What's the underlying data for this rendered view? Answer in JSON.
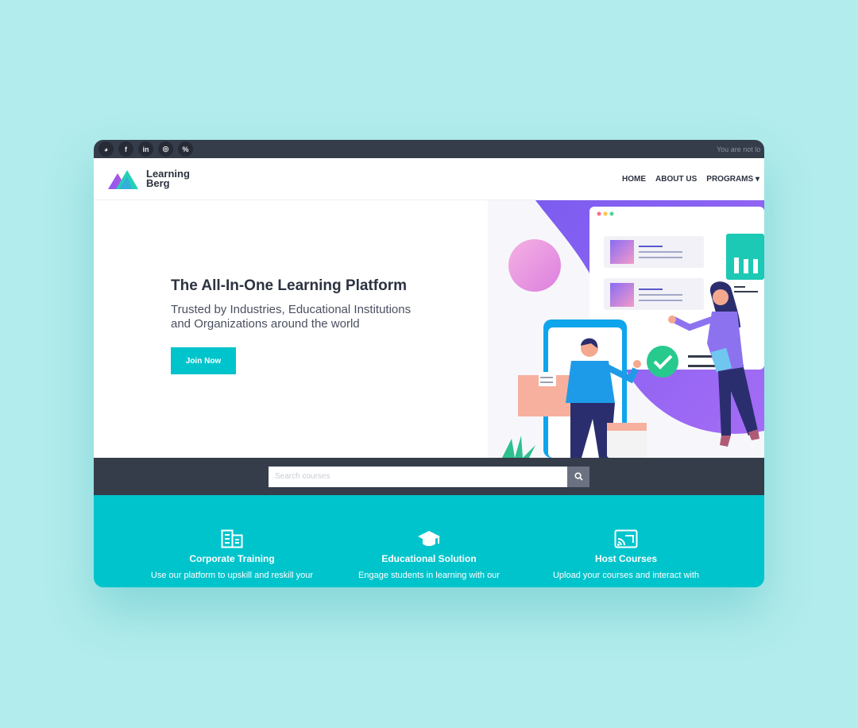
{
  "topbar": {
    "socials": [
      {
        "icon": "globe-icon",
        "glyph": "◕"
      },
      {
        "icon": "facebook-icon",
        "glyph": "f"
      },
      {
        "icon": "linkedin-icon",
        "glyph": "in"
      },
      {
        "icon": "instagram-icon",
        "glyph": "◎"
      },
      {
        "icon": "link-icon",
        "glyph": "%"
      }
    ],
    "login_note": "You are not lo"
  },
  "brand": {
    "line1": "Learning",
    "line2": "Berg"
  },
  "nav": {
    "home": "HOME",
    "about": "ABOUT US",
    "programs": "PROGRAMS"
  },
  "hero": {
    "title": "The All-In-One Learning Platform",
    "subtitle_line1": "Trusted by Industries, Educational Institutions",
    "subtitle_line2": "and Organizations around the world",
    "cta": "Join Now"
  },
  "search": {
    "placeholder": "Search courses"
  },
  "features": [
    {
      "icon": "building-icon",
      "title": "Corporate Training",
      "desc": "Use our platform to upskill and reskill your"
    },
    {
      "icon": "graduation-cap-icon",
      "title": "Educational Solution",
      "desc": "Engage students in learning with our"
    },
    {
      "icon": "cast-icon",
      "title": "Host Courses",
      "desc": "Upload your courses and interact with"
    }
  ],
  "colors": {
    "accent": "#00c4cc",
    "dark": "#353c4a",
    "background": "#b2ecec"
  }
}
